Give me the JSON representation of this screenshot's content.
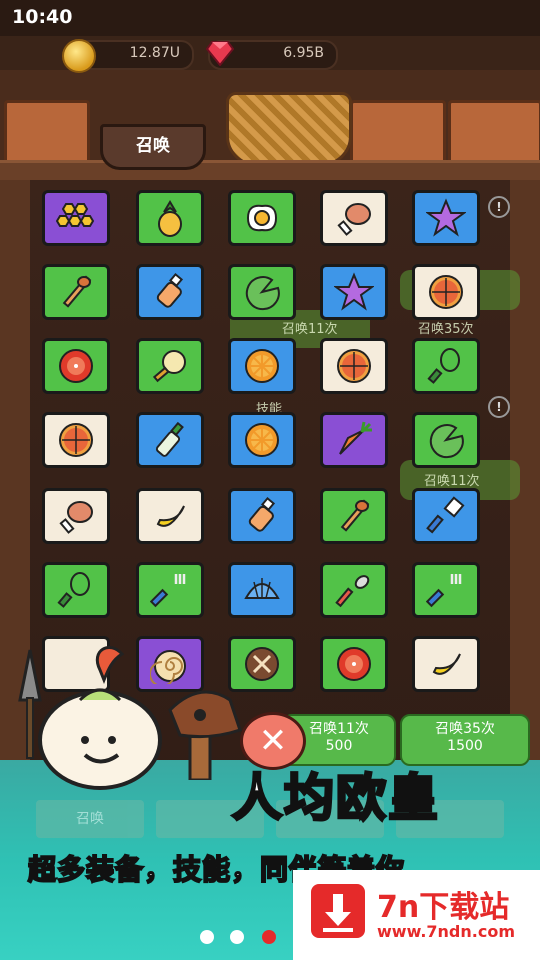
{
  "status_bar": {
    "time": "10:40"
  },
  "resources": {
    "coins": "12.87U",
    "gems": "6.95B"
  },
  "summon_tag": "召唤",
  "grid": [
    [
      {
        "icon": "honeycomb-icon",
        "color": "purple"
      },
      {
        "icon": "pineapple-icon",
        "color": "green"
      },
      {
        "icon": "fried-egg-icon",
        "color": "green"
      },
      {
        "icon": "meat-leg-icon",
        "color": "cream"
      },
      {
        "icon": "starfish-icon",
        "color": "blue"
      }
    ],
    [
      {
        "icon": "honey-dipper-icon",
        "color": "green"
      },
      {
        "icon": "baby-bottle-icon",
        "color": "blue"
      },
      {
        "icon": "lily-pad-icon",
        "color": "green"
      },
      {
        "icon": "starfish-icon",
        "color": "blue"
      },
      {
        "icon": "pizza-icon",
        "color": "cream"
      }
    ],
    [
      {
        "icon": "tomato-slice-icon",
        "color": "green"
      },
      {
        "icon": "frying-pan-icon",
        "color": "green"
      },
      {
        "icon": "orange-slice-icon",
        "color": "blue"
      },
      {
        "icon": "pizza-icon",
        "color": "cream"
      },
      {
        "icon": "whisk-icon",
        "color": "green"
      }
    ],
    [
      {
        "icon": "pizza-icon",
        "color": "cream"
      },
      {
        "icon": "sauce-bottle-icon",
        "color": "blue"
      },
      {
        "icon": "orange-slice-icon",
        "color": "blue"
      },
      {
        "icon": "carrot-icon",
        "color": "purple"
      },
      {
        "icon": "lily-pad-icon",
        "color": "green"
      }
    ],
    [
      {
        "icon": "meat-leg-icon",
        "color": "cream"
      },
      {
        "icon": "banana-icon",
        "color": "cream"
      },
      {
        "icon": "baby-bottle-icon",
        "color": "blue"
      },
      {
        "icon": "honey-dipper-icon",
        "color": "green"
      },
      {
        "icon": "paintbrush-icon",
        "color": "blue"
      }
    ],
    [
      {
        "icon": "whisk-icon",
        "color": "green"
      },
      {
        "icon": "fork-icon",
        "color": "green"
      },
      {
        "icon": "shell-icon",
        "color": "blue"
      },
      {
        "icon": "spoon-icon",
        "color": "green"
      },
      {
        "icon": "fork-icon",
        "color": "green"
      }
    ],
    [
      {
        "icon": "empty",
        "color": "cream"
      },
      {
        "icon": "ammonite-icon",
        "color": "purple"
      },
      {
        "icon": "mushroom-icon",
        "color": "green"
      },
      {
        "icon": "tomato-slice-icon",
        "color": "green"
      },
      {
        "icon": "banana-icon",
        "color": "cream"
      }
    ]
  ],
  "background_labels": {
    "summon_11": "召唤11次",
    "summon_35": "召唤35次",
    "skill": "技能",
    "summon_11_b": "召唤11次"
  },
  "cost_buttons": [
    {
      "label": "召唤11次",
      "cost": "500"
    },
    {
      "label": "召唤35次",
      "cost": "1500"
    }
  ],
  "bottom_tabs": [
    "召唤",
    "",
    "",
    ""
  ],
  "headline": "人均欧皇",
  "subline": "超多装备，技能，同伴等着你",
  "watermark": {
    "brand": "7n下载站",
    "url": "www.7ndn.com"
  },
  "carousel": {
    "count": 3,
    "active": 3
  }
}
